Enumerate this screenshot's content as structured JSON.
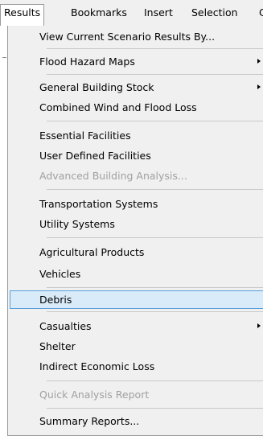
{
  "menubar": {
    "items": [
      "Results",
      "Bookmarks",
      "Insert",
      "Selection",
      "C"
    ]
  },
  "results_menu": {
    "items": [
      {
        "label": "View Current Scenario Results By...",
        "enabled": true,
        "submenu": false
      },
      {
        "label": "Flood Hazard Maps",
        "enabled": true,
        "submenu": true
      },
      {
        "label": "General Building Stock",
        "enabled": true,
        "submenu": true
      },
      {
        "label": "Combined Wind and Flood Loss",
        "enabled": true,
        "submenu": false
      },
      {
        "label": "Essential Facilities",
        "enabled": true,
        "submenu": false
      },
      {
        "label": "User Defined Facilities",
        "enabled": true,
        "submenu": false
      },
      {
        "label": "Advanced Building Analysis...",
        "enabled": false,
        "submenu": false
      },
      {
        "label": "Transportation Systems",
        "enabled": true,
        "submenu": false
      },
      {
        "label": "Utility Systems",
        "enabled": true,
        "submenu": false
      },
      {
        "label": "Agricultural Products",
        "enabled": true,
        "submenu": false
      },
      {
        "label": "Vehicles",
        "enabled": true,
        "submenu": false
      },
      {
        "label": "Debris",
        "enabled": true,
        "submenu": false,
        "highlighted": true
      },
      {
        "label": "Casualties",
        "enabled": true,
        "submenu": true
      },
      {
        "label": "Shelter",
        "enabled": true,
        "submenu": false
      },
      {
        "label": "Indirect Economic Loss",
        "enabled": true,
        "submenu": false
      },
      {
        "label": "Quick Analysis Report",
        "enabled": false,
        "submenu": false
      },
      {
        "label": "Summary Reports...",
        "enabled": true,
        "submenu": false
      }
    ]
  },
  "colors": {
    "menu_background": "#f0f0f0",
    "highlight_fill": "#d9ebf9",
    "highlight_border": "#5aa0dc",
    "disabled_text": "#a0a0a0"
  }
}
